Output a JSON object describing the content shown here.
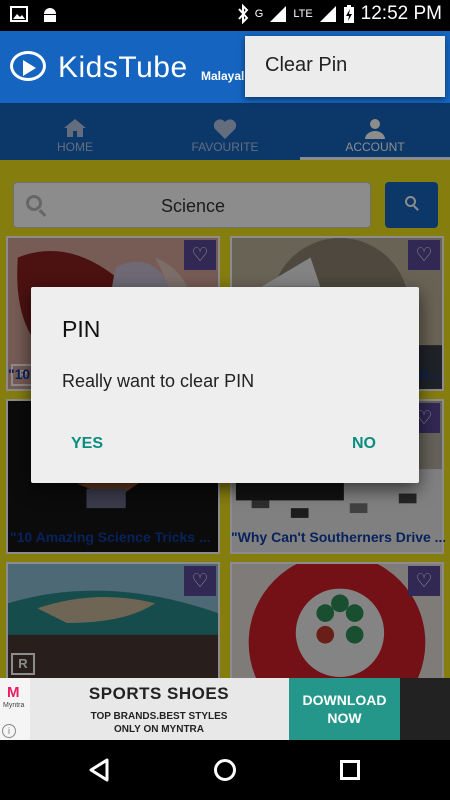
{
  "status_bar": {
    "time": "12:52 PM",
    "network": "G",
    "lte": "LTE"
  },
  "app": {
    "title": "KidsTube",
    "language": "Malayal"
  },
  "menu": {
    "items": [
      "Clear Pin"
    ]
  },
  "tabs": [
    {
      "label": "HOME",
      "icon": "home-icon",
      "selected": false
    },
    {
      "label": "FAVOURITE",
      "icon": "heart-icon",
      "selected": false
    },
    {
      "label": "ACCOUNT",
      "icon": "person-icon",
      "selected": true
    }
  ],
  "search": {
    "value": "Science"
  },
  "videos": [
    {
      "title": "\"10"
    },
    {
      "title": "...ri..."
    },
    {
      "title": "\"10 Amazing Science Tricks ..."
    },
    {
      "title": "\"Why Can't Southerners Drive ..."
    },
    {
      "title": ""
    },
    {
      "title": ""
    }
  ],
  "dialog": {
    "title": "PIN",
    "message": "Really want to clear PIN",
    "yes_label": "YES",
    "no_label": "NO"
  },
  "ad": {
    "brand": "Myntra",
    "brand_letter": "M",
    "headline": "SPORTS SHOES",
    "subline_1": "TOP BRANDS.BEST STYLES",
    "subline_2": "ONLY ON MYNTRA",
    "cta_line_1": "DOWNLOAD",
    "cta_line_2": "NOW",
    "info": "i"
  },
  "colors": {
    "primary": "#1565c0",
    "content_bg": "#f4e31c",
    "accent_text": "#0a8d7e",
    "fav_button": "#5b4a9a",
    "title_text": "#0d3ea8"
  }
}
